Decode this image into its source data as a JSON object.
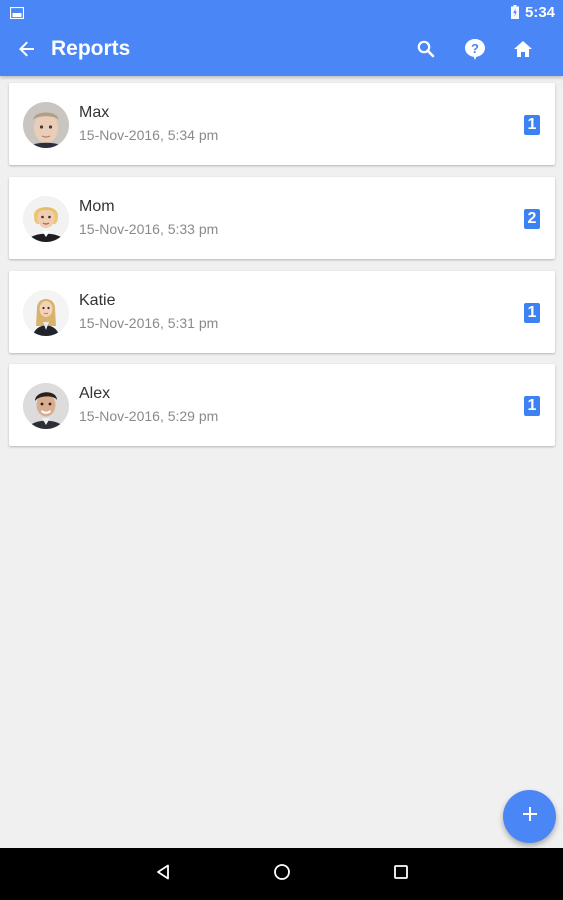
{
  "status_bar": {
    "time": "5:34"
  },
  "app_bar": {
    "title": "Reports",
    "actions": [
      "search-icon",
      "help-icon",
      "home-icon"
    ]
  },
  "reports": [
    {
      "name": "Max",
      "date": "15-Nov-2016, 5:34 pm",
      "count": "1",
      "avatar": "boy"
    },
    {
      "name": "Mom",
      "date": "15-Nov-2016, 5:33 pm",
      "count": "2",
      "avatar": "woman-short-blonde"
    },
    {
      "name": "Katie",
      "date": "15-Nov-2016, 5:31 pm",
      "count": "1",
      "avatar": "woman-long-blonde"
    },
    {
      "name": "Alex",
      "date": "15-Nov-2016, 5:29 pm",
      "count": "1",
      "avatar": "man-dark-hair"
    }
  ],
  "fab": {
    "icon": "plus-icon"
  },
  "nav_bar": {
    "buttons": [
      "back-triangle-icon",
      "home-circle-icon",
      "recents-square-icon"
    ]
  },
  "colors": {
    "primary": "#4a86f5",
    "badge": "#3d82f3",
    "background": "#f0f0f0"
  }
}
